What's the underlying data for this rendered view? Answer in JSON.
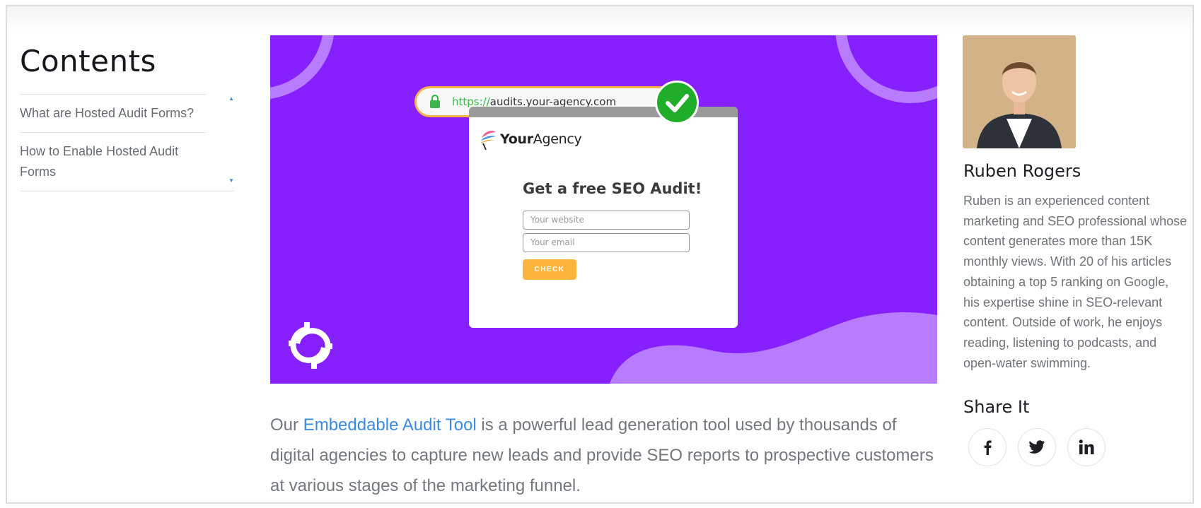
{
  "sidebar": {
    "title": "Contents",
    "items": [
      {
        "label": "What are Hosted Audit Forms?"
      },
      {
        "label": "How to Enable Hosted Audit Forms"
      }
    ]
  },
  "hero": {
    "url_protocol": "https://",
    "url_host": "audits.your-agency.com",
    "agency_name_bold": "Your",
    "agency_name_rest": "Agency",
    "form_heading": "Get a free SEO Audit!",
    "website_placeholder": "Your website",
    "email_placeholder": "Your email",
    "check_label": "CHECK",
    "colors": {
      "background": "#8620ff",
      "check_badge": "#1fad2a",
      "button": "#fdb43c"
    }
  },
  "article": {
    "intro_before": "Our ",
    "intro_link": "Embeddable Audit Tool",
    "intro_after": " is a powerful lead generation tool used by thousands of digital agencies to capture new leads and provide SEO reports to prospective customers at various stages of the marketing funnel."
  },
  "author": {
    "name": "Ruben Rogers",
    "bio": "Ruben is an experienced content marketing and SEO professional whose content generates more than 15K monthly views. With 20 of his articles obtaining a top 5 ranking on Google, his expertise shine in SEO-relevant content. Outside of work, he enjoys reading, listening to podcasts, and open-water swimming."
  },
  "share": {
    "title": "Share It",
    "buttons": [
      {
        "icon": "facebook-icon"
      },
      {
        "icon": "twitter-icon"
      },
      {
        "icon": "linkedin-icon"
      }
    ]
  }
}
